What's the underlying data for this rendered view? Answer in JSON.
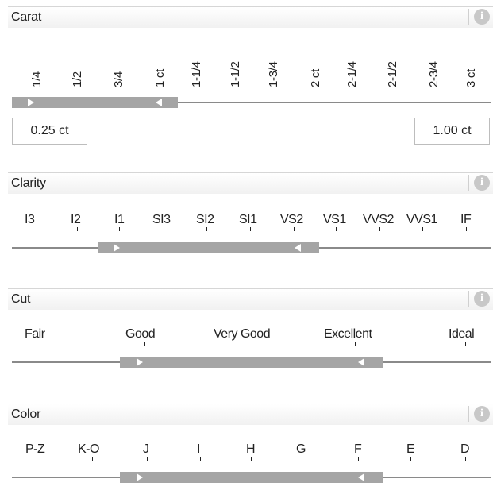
{
  "carat": {
    "title": "Carat",
    "labels": [
      "1/4",
      "1/2",
      "3/4",
      "1 ct",
      "1-1/4",
      "1-1/2",
      "1-3/4",
      "2 ct",
      "2-1/4",
      "2-1/2",
      "2-3/4",
      "3 ct"
    ],
    "min_value": "0.25 ct",
    "max_value": "1.00 ct"
  },
  "clarity": {
    "title": "Clarity",
    "labels": [
      "I3",
      "I2",
      "I1",
      "SI3",
      "SI2",
      "SI1",
      "VS2",
      "VS1",
      "VVS2",
      "VVS1",
      "IF"
    ]
  },
  "cut": {
    "title": "Cut",
    "labels": [
      "Fair",
      "Good",
      "Very Good",
      "Excellent",
      "Ideal"
    ]
  },
  "color": {
    "title": "Color",
    "labels": [
      "P-Z",
      "K-O",
      "J",
      "I",
      "H",
      "G",
      "F",
      "E",
      "D"
    ]
  },
  "info_glyph": "i",
  "icons": {
    "info": "info-icon",
    "min_handle": "slider-min-handle",
    "max_handle": "slider-max-handle"
  }
}
